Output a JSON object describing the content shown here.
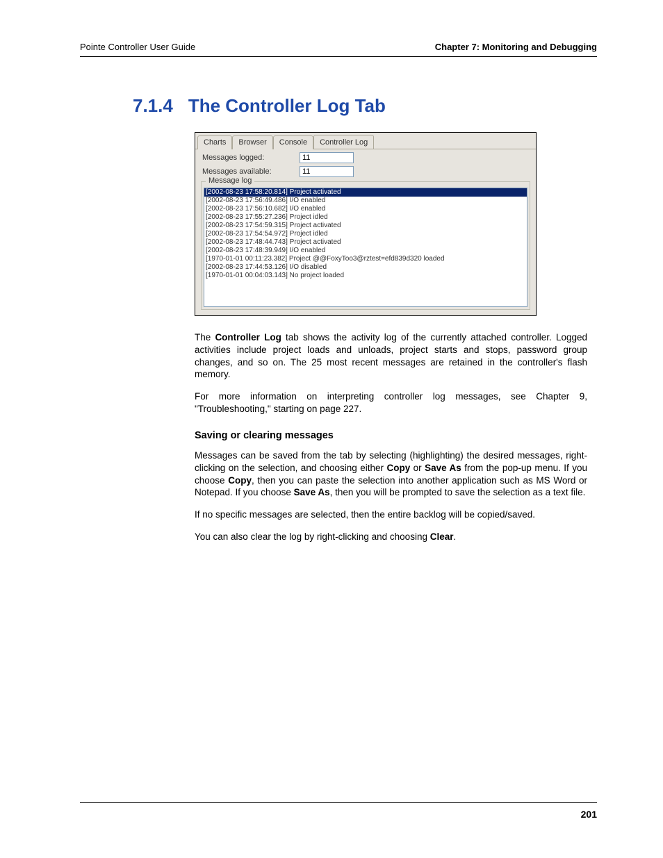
{
  "header": {
    "left": "Pointe Controller User Guide",
    "right": "Chapter 7: Monitoring and Debugging"
  },
  "heading": {
    "number": "7.1.4",
    "title": "The Controller Log Tab"
  },
  "screenshot": {
    "tabs": [
      "Charts",
      "Browser",
      "Console",
      "Controller Log"
    ],
    "active_tab_index": 3,
    "msgs_logged_label": "Messages logged:",
    "msgs_logged_value": "11",
    "msgs_available_label": "Messages available:",
    "msgs_available_value": "11",
    "groupbox_legend": "Message log",
    "log_lines": [
      "[2002-08-23 17:58:20.814] Project activated",
      "[2002-08-23 17:56:49.486] I/O enabled",
      "[2002-08-23 17:56:10.682] I/O enabled",
      "[2002-08-23 17:55:27.236] Project idled",
      "[2002-08-23 17:54:59.315] Project activated",
      "[2002-08-23 17:54:54.972] Project idled",
      "[2002-08-23 17:48:44.743] Project activated",
      "[2002-08-23 17:48:39.949] I/O enabled",
      "[1970-01-01 00:11:23.382] Project @@FoxyToo3@rztest=efd839d320 loaded",
      "[2002-08-23 17:44:53.126] I/O disabled",
      "[1970-01-01 00:04:03.143] No project loaded"
    ],
    "selected_line_index": 0
  },
  "body": {
    "p1_a": "The ",
    "p1_b": "Controller Log",
    "p1_c": " tab shows the activity log of the currently attached controller. Logged activities include project loads and unloads, project starts and stops, password group changes, and so on. The 25 most recent messages are retained in the controller's flash memory.",
    "p2": "For more information on interpreting controller log messages, see Chapter 9, \"Troubleshooting,\" starting on page 227.",
    "subhead": "Saving or clearing messages",
    "p3_a": "Messages can be saved from the tab by selecting (highlighting) the desired messages, right-clicking on the selection, and choosing either ",
    "p3_b": "Copy",
    "p3_c": " or ",
    "p3_d": "Save As",
    "p3_e": " from the pop-up menu. If you choose ",
    "p3_f": "Copy",
    "p3_g": ", then you can paste the selection into another application such as MS Word or Notepad. If you choose ",
    "p3_h": "Save As",
    "p3_i": ", then you will be prompted to save the selection as a text file.",
    "p4": "If no specific messages are selected, then the entire backlog will be copied/saved.",
    "p5_a": "You can also clear the log by right-clicking and choosing ",
    "p5_b": "Clear",
    "p5_c": "."
  },
  "footer": {
    "page_number": "201"
  }
}
